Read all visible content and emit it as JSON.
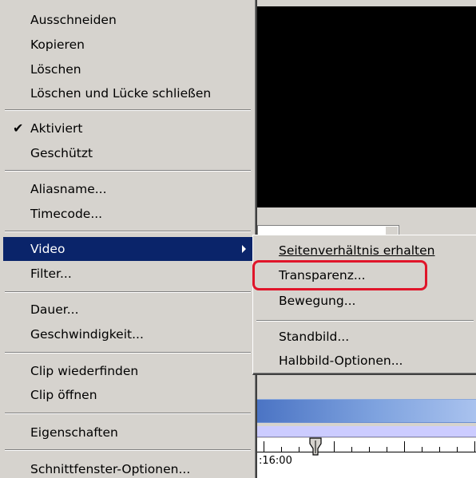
{
  "context_menu": {
    "items": [
      {
        "label": "Ausschneiden"
      },
      {
        "label": "Kopieren"
      },
      {
        "label": "Löschen"
      },
      {
        "label": "Löschen und Lücke schließen"
      },
      {
        "label": "Aktiviert",
        "checked": true,
        "check_glyph": "✔"
      },
      {
        "label": "Geschützt"
      },
      {
        "label": "Aliasname..."
      },
      {
        "label": "Timecode..."
      },
      {
        "label": "Video",
        "highlighted": true,
        "has_submenu": true
      },
      {
        "label": "Filter..."
      },
      {
        "label": "Dauer..."
      },
      {
        "label": "Geschwindigkeit..."
      },
      {
        "label": "Clip wiederfinden"
      },
      {
        "label": "Clip öffnen"
      },
      {
        "label": "Eigenschaften"
      },
      {
        "label": "Schnittfenster-Optionen..."
      }
    ],
    "highlight_color": "#0a246a",
    "background_color": "#d6d3ce"
  },
  "video_submenu": {
    "items": [
      {
        "label": "Seitenverhältnis erhalten"
      },
      {
        "label": "Transparenz...",
        "annotated": true
      },
      {
        "label": "Bewegung..."
      },
      {
        "label": "Standbild..."
      },
      {
        "label": "Halbbild-Optionen..."
      }
    ],
    "annotation_color": "#e0152a"
  },
  "timeline": {
    "timecode": ":16:00",
    "clip_color": "#7fa3df",
    "track_color": "#ccccff"
  },
  "preview": {
    "background_color": "#000000"
  }
}
